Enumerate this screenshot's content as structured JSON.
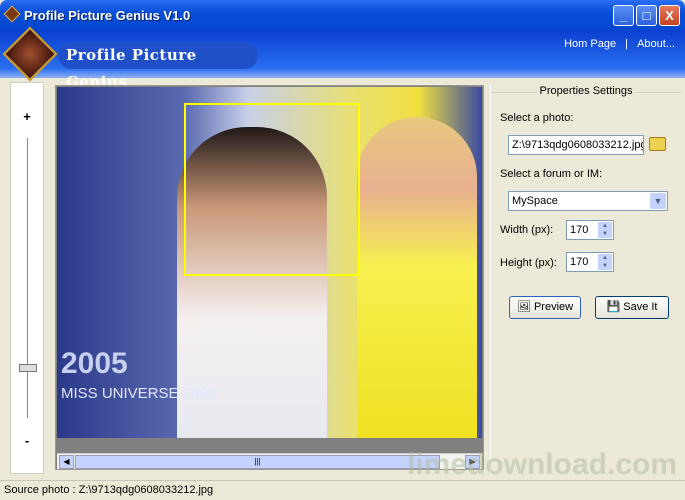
{
  "window": {
    "title": "Profile Picture Genius V1.0",
    "min": "_",
    "max": "□",
    "close": "X"
  },
  "header": {
    "logo_text": "Profile Picture Genius",
    "links": [
      "Hom Page",
      "|",
      "About..."
    ]
  },
  "zoom": {
    "plus": "+",
    "minus": "-",
    "level": 0.82
  },
  "photo": {
    "brand_line1": "2005",
    "brand_line2": "MISS UNIVERSE 2005"
  },
  "panel": {
    "title": "Properties Settings",
    "photo_label": "Select a photo:",
    "photo_value": "Z:\\9713qdg0608033212.jpg",
    "forum_label": "Select a forum or IM:",
    "forum_value": "MySpace",
    "width_label": "Width (px):",
    "width_value": "170",
    "height_label": "Height (px):",
    "height_value": "170",
    "preview": "Preview",
    "save": "Save It"
  },
  "status": "Source photo : Z:\\9713qdg0608033212.jpg",
  "watermark": "limedownload.com"
}
